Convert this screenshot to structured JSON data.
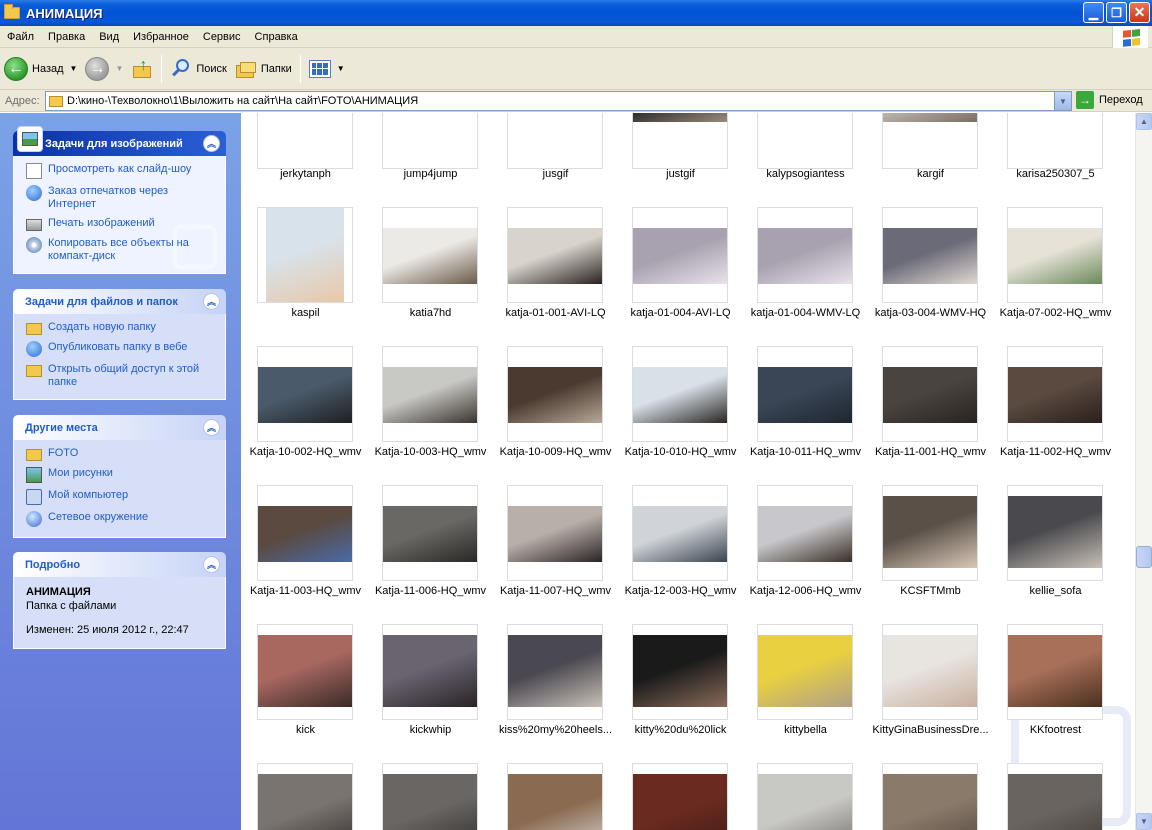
{
  "window": {
    "title": "АНИМАЦИЯ"
  },
  "menu": [
    "Файл",
    "Правка",
    "Вид",
    "Избранное",
    "Сервис",
    "Справка"
  ],
  "toolbar": {
    "back_label": "Назад",
    "search_label": "Поиск",
    "folders_label": "Папки"
  },
  "address": {
    "label": "Адрес:",
    "path": "D:\\кино-\\Техволокно\\1\\Выложить на сайт\\На сайт\\FOTO\\АНИМАЦИЯ",
    "go_label": "Переход"
  },
  "panels": {
    "image_tasks": {
      "title": "Задачи для изображений",
      "items": [
        "Просмотреть как слайд-шоу",
        "Заказ отпечатков через Интернет",
        "Печать изображений",
        "Копировать все объекты на компакт-диск"
      ]
    },
    "file_tasks": {
      "title": "Задачи для файлов и папок",
      "items": [
        "Создать новую папку",
        "Опубликовать папку в вебе",
        "Открыть общий доступ к этой папке"
      ]
    },
    "other_places": {
      "title": "Другие места",
      "items": [
        "FOTO",
        "Мои рисунки",
        "Мой компьютер",
        "Сетевое окружение"
      ]
    },
    "details": {
      "title": "Подробно",
      "name": "АНИМАЦИЯ",
      "type": "Папка с файлами",
      "modified": "Изменен: 25 июля 2012 г., 22:47"
    }
  },
  "files": [
    {
      "name": "jerkytanph"
    },
    {
      "name": "jump4jump"
    },
    {
      "name": "jusgif"
    },
    {
      "name": "justgif"
    },
    {
      "name": "kalypsogiantess"
    },
    {
      "name": "kargif"
    },
    {
      "name": "karisa250307_5"
    },
    {
      "name": "kaspil"
    },
    {
      "name": "katia7hd"
    },
    {
      "name": "katja-01-001-AVI-LQ"
    },
    {
      "name": "katja-01-004-AVI-LQ"
    },
    {
      "name": "katja-01-004-WMV-LQ"
    },
    {
      "name": "katja-03-004-WMV-HQ"
    },
    {
      "name": "Katja-07-002-HQ_wmv"
    },
    {
      "name": "Katja-10-002-HQ_wmv"
    },
    {
      "name": "Katja-10-003-HQ_wmv"
    },
    {
      "name": "Katja-10-009-HQ_wmv"
    },
    {
      "name": "Katja-10-010-HQ_wmv"
    },
    {
      "name": "Katja-10-011-HQ_wmv"
    },
    {
      "name": "Katja-11-001-HQ_wmv"
    },
    {
      "name": "Katja-11-002-HQ_wmv"
    },
    {
      "name": "Katja-11-003-HQ_wmv"
    },
    {
      "name": "Katja-11-006-HQ_wmv"
    },
    {
      "name": "Katja-11-007-HQ_wmv"
    },
    {
      "name": "Katja-12-003-HQ_wmv"
    },
    {
      "name": "Katja-12-006-HQ_wmv"
    },
    {
      "name": "KCSFTMmb"
    },
    {
      "name": "kellie_sofa"
    },
    {
      "name": "kick"
    },
    {
      "name": "kickwhip"
    },
    {
      "name": "kiss%20my%20heels..."
    },
    {
      "name": "kitty%20du%20lick"
    },
    {
      "name": "kittybella"
    },
    {
      "name": "KittyGinaBusinessDre..."
    },
    {
      "name": "KKfootrest"
    },
    {
      "name": ""
    },
    {
      "name": ""
    },
    {
      "name": ""
    },
    {
      "name": ""
    },
    {
      "name": ""
    },
    {
      "name": ""
    },
    {
      "name": ""
    }
  ],
  "colors": {
    "titlebar": "#0052d4",
    "taskpane": "#6f8de0",
    "link": "#215dc6"
  }
}
